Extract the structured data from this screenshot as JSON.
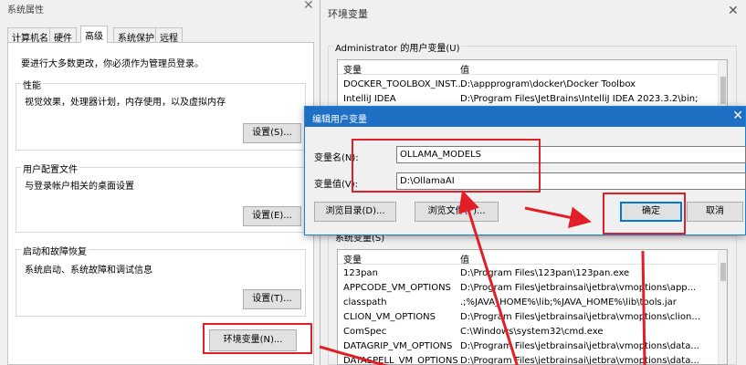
{
  "sys": {
    "title": "系统属性",
    "tabs": [
      "计算机名",
      "硬件",
      "高级",
      "系统保护",
      "远程"
    ],
    "admin_note": "要进行大多数更改，你必须作为管理员登录。",
    "perf": {
      "title": "性能",
      "desc": "视觉效果，处理器计划，内存使用，以及虚拟内存",
      "button": "设置(S)..."
    },
    "profile": {
      "title": "用户配置文件",
      "desc": "与登录帐户相关的桌面设置",
      "button": "设置(E)..."
    },
    "startup": {
      "title": "启动和故障恢复",
      "desc": "系统启动、系统故障和调试信息",
      "button": "设置(T)..."
    },
    "env_button": "环境变量(N)..."
  },
  "env": {
    "title": "环境变量",
    "user_section": "Administrator 的用户变量(U)",
    "system_section": "系统变量(S)",
    "col_var": "变量",
    "col_val": "值",
    "user_vars": [
      {
        "name": "DOCKER_TOOLBOX_INST...",
        "value": "D:\\appprogram\\docker\\Docker Toolbox"
      },
      {
        "name": "IntelliJ IDEA",
        "value": "D:\\Program Files\\JetBrains\\IntelliJ IDEA 2023.3.2\\bin;"
      }
    ],
    "system_vars": [
      {
        "name": "123pan",
        "value": "D:\\Program Files\\123pan\\123pan.exe"
      },
      {
        "name": "APPCODE_VM_OPTIONS",
        "value": "D:\\Program Files\\jetbrainsai\\jetbra\\vmoptions\\app..."
      },
      {
        "name": "classpath",
        "value": ".;%JAVA_HOME%\\lib;%JAVA_HOME%\\lib\\tools.jar"
      },
      {
        "name": "CLION_VM_OPTIONS",
        "value": "D:\\Program Files\\jetbrainsai\\jetbra\\vmoptions\\clion..."
      },
      {
        "name": "ComSpec",
        "value": "C:\\Windows\\system32\\cmd.exe"
      },
      {
        "name": "DATAGRIP_VM_OPTIONS",
        "value": "D:\\Program Files\\jetbrainsai\\jetbra\\vmoptions\\data..."
      },
      {
        "name": "DATASPELL_VM_OPTIONS",
        "value": "D:\\Program Files\\jetbrainsai\\jetbra\\vmoptions\\data..."
      }
    ]
  },
  "edit": {
    "title": "编辑用户变量",
    "name_label": "变量名(N):",
    "name_value": "OLLAMA_MODELS",
    "value_label": "变量值(V):",
    "value_value": "D:\\OllamaAI",
    "browse_dir": "浏览目录(D)...",
    "browse_file": "浏览文件(F)...",
    "ok": "确定",
    "cancel": "取消"
  },
  "colors": {
    "accent": "#0078d7",
    "titlebar": "#1f6fc5",
    "annotation": "#e21f26"
  }
}
